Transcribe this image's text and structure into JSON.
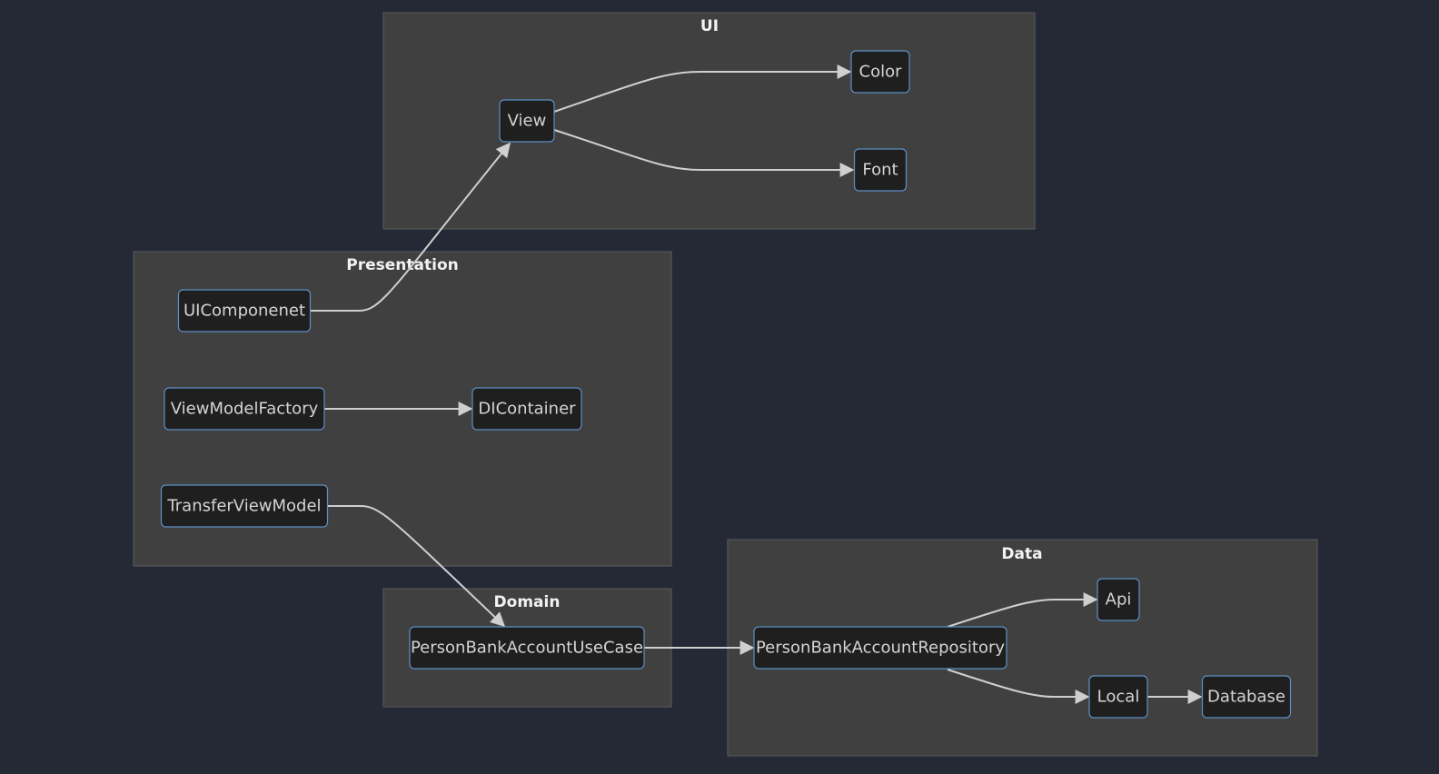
{
  "diagram": {
    "type": "flowchart",
    "direction": "LR",
    "colors": {
      "background": "#252936",
      "cluster_fill": "#3f403f",
      "node_fill": "#1f1f1f",
      "node_border": "#5e8fc4",
      "edge": "#cfcfcf",
      "text": "#d4d4d4"
    },
    "clusters": [
      {
        "id": "ui",
        "title": "UI"
      },
      {
        "id": "presentation",
        "title": "Presentation"
      },
      {
        "id": "domain",
        "title": "Domain"
      },
      {
        "id": "data",
        "title": "Data"
      }
    ],
    "nodes": [
      {
        "id": "View",
        "label": "View",
        "cluster": "ui"
      },
      {
        "id": "Color",
        "label": "Color",
        "cluster": "ui"
      },
      {
        "id": "Font",
        "label": "Font",
        "cluster": "ui"
      },
      {
        "id": "UIComponenet",
        "label": "UIComponenet",
        "cluster": "presentation"
      },
      {
        "id": "ViewModelFactory",
        "label": "ViewModelFactory",
        "cluster": "presentation"
      },
      {
        "id": "DIContainer",
        "label": "DIContainer",
        "cluster": "presentation"
      },
      {
        "id": "TransferViewModel",
        "label": "TransferViewModel",
        "cluster": "presentation"
      },
      {
        "id": "PersonBankAccountUseCase",
        "label": "PersonBankAccountUseCase",
        "cluster": "domain"
      },
      {
        "id": "PersonBankAccountRepository",
        "label": "PersonBankAccountRepository",
        "cluster": "data"
      },
      {
        "id": "Api",
        "label": "Api",
        "cluster": "data"
      },
      {
        "id": "Local",
        "label": "Local",
        "cluster": "data"
      },
      {
        "id": "Database",
        "label": "Database",
        "cluster": "data"
      }
    ],
    "edges": [
      {
        "from": "View",
        "to": "Color"
      },
      {
        "from": "View",
        "to": "Font"
      },
      {
        "from": "UIComponenet",
        "to": "View"
      },
      {
        "from": "ViewModelFactory",
        "to": "DIContainer"
      },
      {
        "from": "TransferViewModel",
        "to": "PersonBankAccountUseCase"
      },
      {
        "from": "PersonBankAccountUseCase",
        "to": "PersonBankAccountRepository"
      },
      {
        "from": "PersonBankAccountRepository",
        "to": "Api"
      },
      {
        "from": "PersonBankAccountRepository",
        "to": "Local"
      },
      {
        "from": "Local",
        "to": "Database"
      }
    ]
  }
}
